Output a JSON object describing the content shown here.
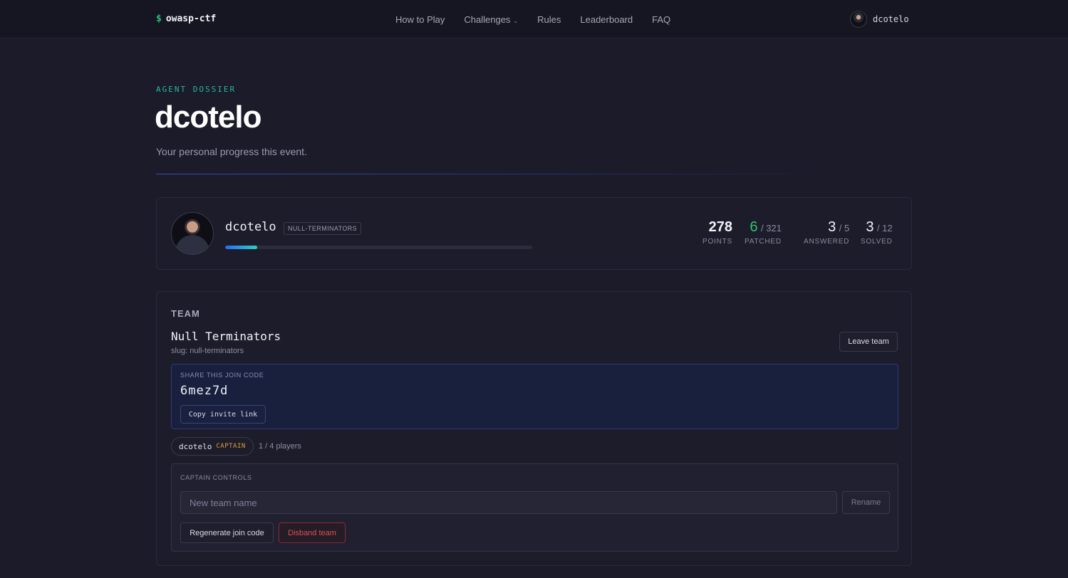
{
  "nav": {
    "brand_symbol": "$",
    "brand_name": "owasp-ctf",
    "items": [
      {
        "label": "How to Play"
      },
      {
        "label": "Challenges"
      },
      {
        "label": "Rules"
      },
      {
        "label": "Leaderboard"
      },
      {
        "label": "FAQ"
      }
    ],
    "username": "dcotelo"
  },
  "hero": {
    "eyebrow": "AGENT DOSSIER",
    "title": "dcotelo",
    "subtitle": "Your personal progress this event."
  },
  "profile": {
    "name": "dcotelo",
    "team_tag": "NULL-TERMINATORS",
    "progress_fraction": 0.105,
    "stats": {
      "points": {
        "value": "278",
        "label": "POINTS"
      },
      "patched": {
        "value": "6",
        "total": "321",
        "label": "PATCHED"
      },
      "answered": {
        "value": "3",
        "total": "5",
        "label": "ANSWERED"
      },
      "solved": {
        "value": "3",
        "total": "12",
        "label": "SOLVED"
      }
    }
  },
  "team": {
    "section_title": "TEAM",
    "name": "Null Terminators",
    "slug": "slug: null-terminators",
    "leave_label": "Leave team",
    "join": {
      "label": "SHARE THIS JOIN CODE",
      "code": "6mez7d",
      "copy_label": "Copy invite link"
    },
    "members": [
      {
        "name": "dcotelo",
        "role": "CAPTAIN"
      }
    ],
    "player_count": "1 / 4 players",
    "captain_controls": {
      "label": "CAPTAIN CONTROLS",
      "rename_placeholder": "New team name",
      "rename_label": "Rename",
      "regenerate_label": "Regenerate join code",
      "disband_label": "Disband team"
    }
  },
  "colors": {
    "accent_teal": "#2bb5a0",
    "success_green": "#31c46f",
    "captain_gold": "#d9a23a",
    "danger_red": "#e05050"
  }
}
